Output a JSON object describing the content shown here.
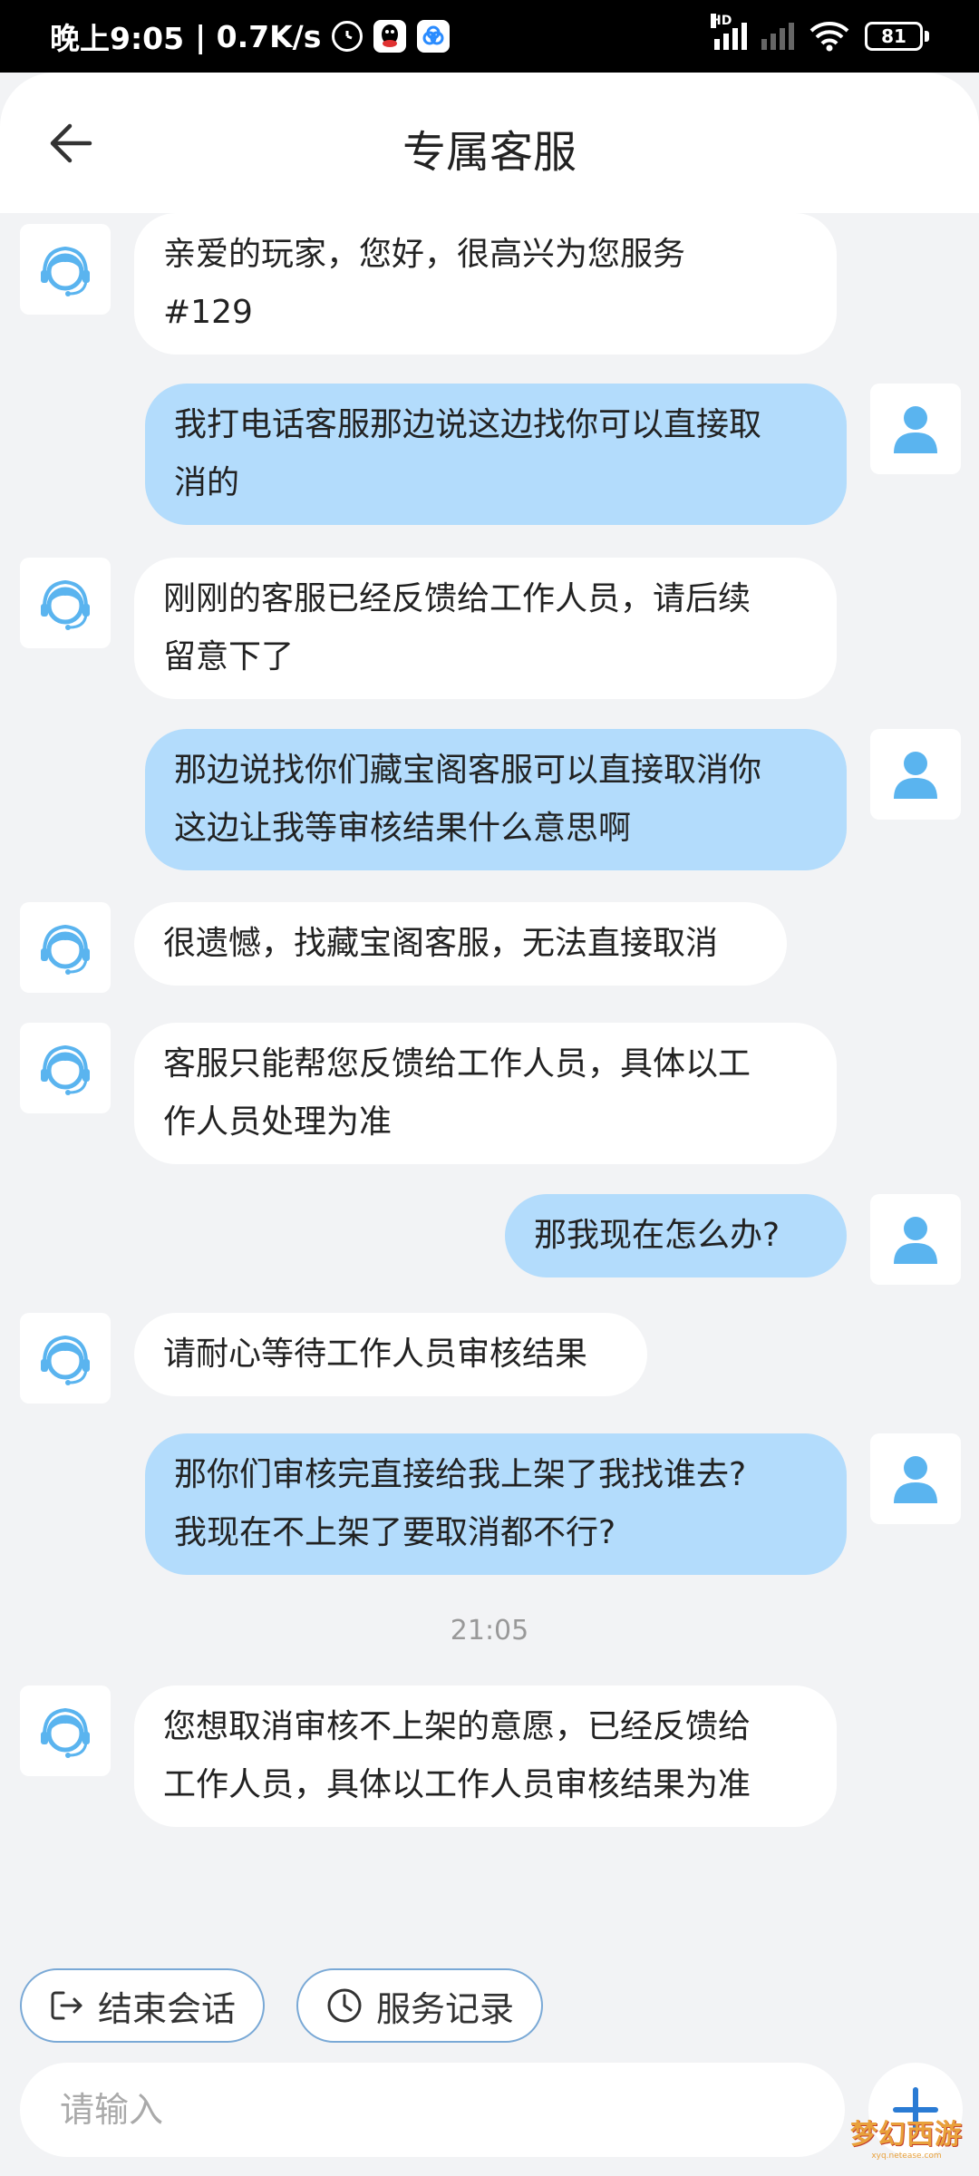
{
  "status_bar": {
    "time": "晚上9:05",
    "net_speed": "| 0.7K/s",
    "signal_label": "HD",
    "battery": "81"
  },
  "header": {
    "title": "专属客服"
  },
  "messages": [
    {
      "from": "agent",
      "text": "亲爱的玩家，您好，很高兴为您服务\n#129"
    },
    {
      "from": "user",
      "text": "我打电话客服那边说这边找你可以直接取\n消的"
    },
    {
      "from": "agent",
      "text": "刚刚的客服已经反馈给工作人员，请后续\n留意下了"
    },
    {
      "from": "user",
      "text": "那边说找你们藏宝阁客服可以直接取消你\n这边让我等审核结果什么意思啊"
    },
    {
      "from": "agent",
      "text": "很遗憾，找藏宝阁客服，无法直接取消"
    },
    {
      "from": "agent",
      "text": "客服只能帮您反馈给工作人员，具体以工\n作人员处理为准"
    },
    {
      "from": "user",
      "text": "那我现在怎么办?"
    },
    {
      "from": "agent",
      "text": "请耐心等待工作人员审核结果"
    },
    {
      "from": "user",
      "text": "那你们审核完直接给我上架了我找谁去?\n我现在不上架了要取消都不行?"
    },
    {
      "from": "agent",
      "text": "您想取消审核不上架的意愿，已经反馈给\n工作人员，具体以工作人员审核结果为准"
    }
  ],
  "timestamp": "21:05",
  "actions": {
    "end_chat": "结束会话",
    "service_record": "服务记录"
  },
  "input": {
    "placeholder": "请输入",
    "value": ""
  },
  "watermark": {
    "title": "梦幻西游",
    "url": "xyq.netease.com"
  },
  "colors": {
    "user_bubble": "#b3dcfc",
    "agent_bubble": "#ffffff",
    "background": "#f2f3f5",
    "avatar_blue": "#5ab4ef",
    "accent": "#2a7bd4"
  }
}
